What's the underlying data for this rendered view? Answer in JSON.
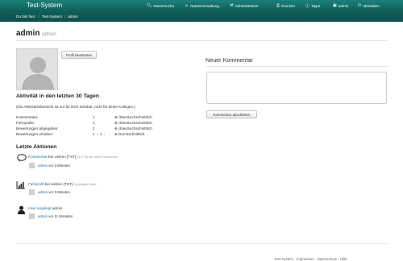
{
  "brand": "Test-System",
  "nav": {
    "search": "Nutzersuche",
    "usermgmt": "Nutzerverwaltung",
    "admin": "Administration",
    "prints": "Drucken",
    "tips": "Tipps",
    "user": "admin",
    "logout": "Abmelden"
  },
  "breadcrumb": {
    "you_are_here": "Du bist hier:",
    "sep": "/",
    "system": "Test-System",
    "current": "admin"
  },
  "profile": {
    "name": "admin",
    "subname": "admin",
    "edit_button": "Profil bearbeiten"
  },
  "activity": {
    "heading": "Aktivität in den letzten 30 Tagen",
    "note": "(Die Aktivitätsübersicht ist nur für Dich sichtbar, nicht für deine Kollegen.)",
    "rows": [
      {
        "label": "Kommentare:",
        "value": "1",
        "rating": "Überdurchschnittlich"
      },
      {
        "label": "Fahrprofile:",
        "value": "1",
        "rating": "Überdurchschnittlich"
      },
      {
        "label": "Bewertungen abgegeben:",
        "value": "2",
        "rating": "Überdurchschnittlich"
      },
      {
        "label": "Bewertungen erhalten:",
        "value": "1",
        "value_up": "1",
        "value_down": "1",
        "rating": "Durchschnittlich"
      }
    ]
  },
  "recent": {
    "heading": "Letzte Aktionen",
    "items": [
      {
        "icon": "speech-bubble-icon",
        "link": "Kommentar",
        "text": "bei Uelzen [TST]",
        "extra": "#137 ist die letzte Fahrstrecke",
        "user": "admin",
        "time": "vor 3 Minuten"
      },
      {
        "icon": "chart-icon",
        "link": "Fahrprofil",
        "text": "bei Uelzen [TST]",
        "extra": "Gespätigte Fahrt",
        "user": "admin",
        "time": "vor 3 Minuten"
      },
      {
        "icon": "user-icon",
        "link": "User angelegt",
        "text": "admin",
        "extra": "",
        "user": "admin",
        "time": "vor 11 Monaten"
      }
    ]
  },
  "comment": {
    "heading": "Neuer Kommentar",
    "submit": "Kommentar abschicken"
  },
  "footer": {
    "text": "Test-System · Impressum · Datenschutz · Hilfe"
  },
  "colors": {
    "navbar": "#1d7f7a",
    "link": "#1f6fa8"
  }
}
